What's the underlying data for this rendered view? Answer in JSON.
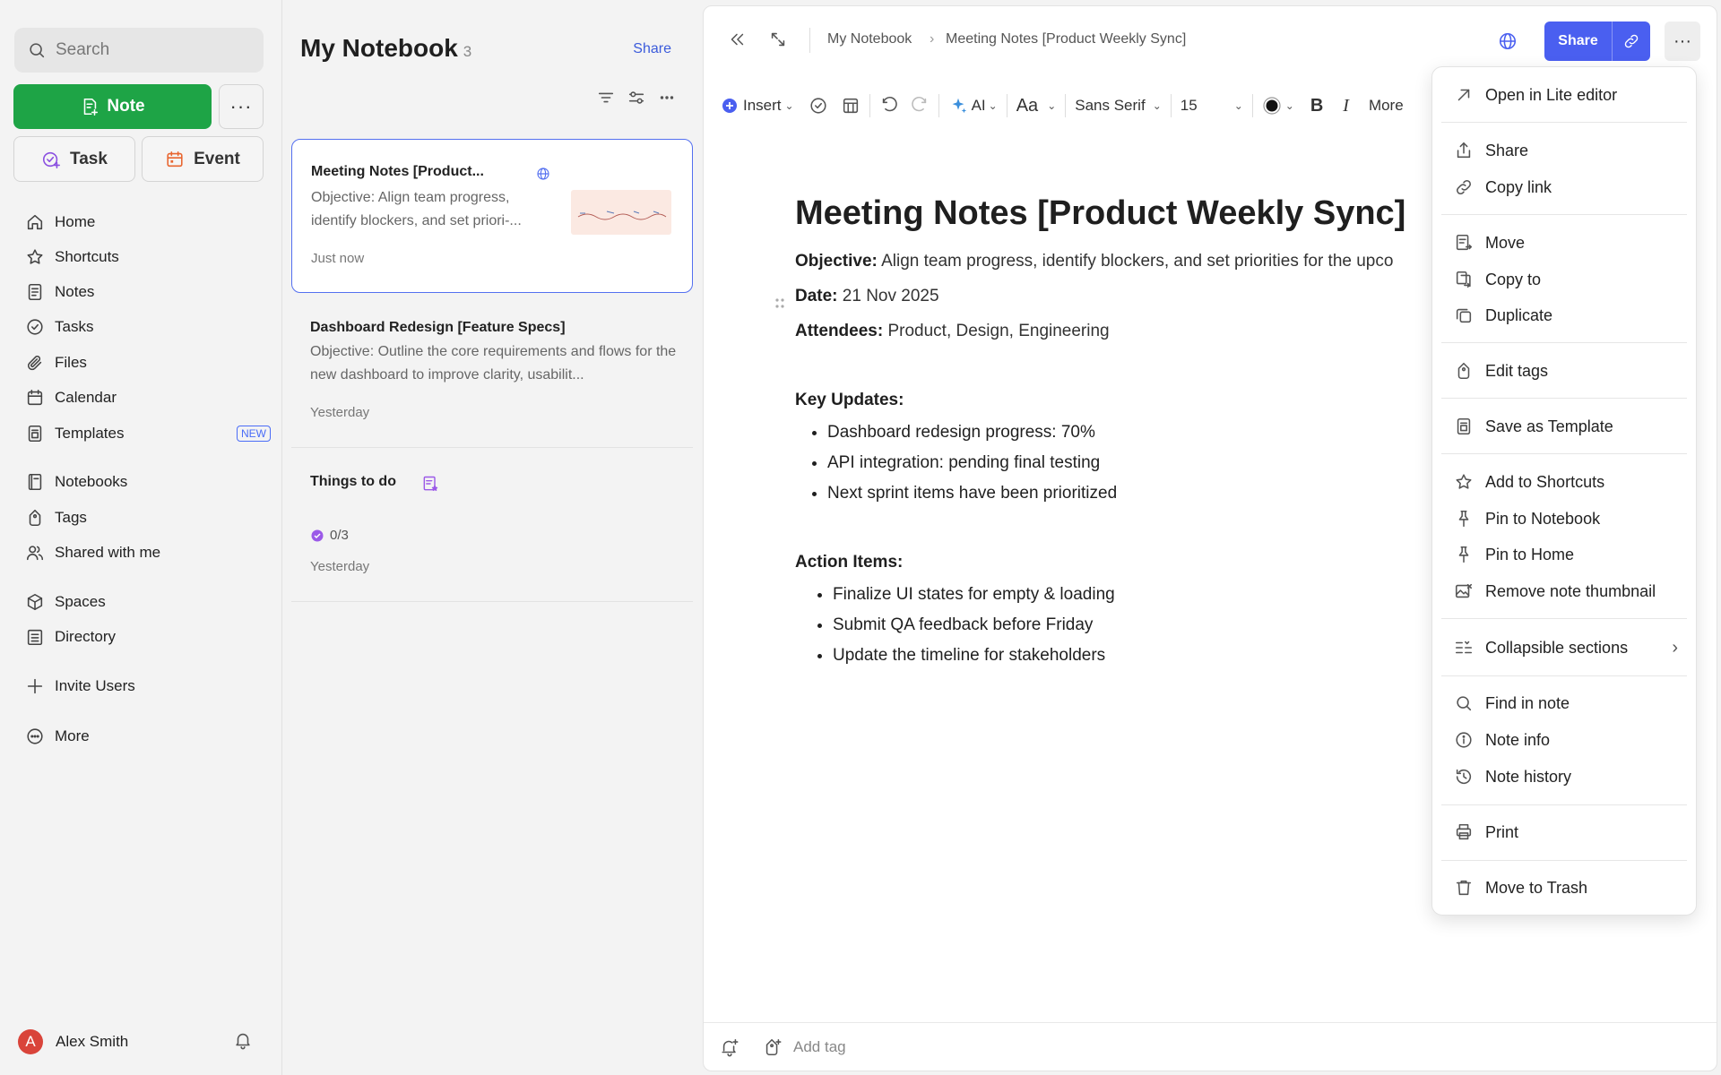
{
  "sidebar": {
    "search_placeholder": "Search",
    "note_button": "Note",
    "more_button": "···",
    "task_button": "Task",
    "event_button": "Event",
    "nav": [
      {
        "label": "Home",
        "icon": "home-icon"
      },
      {
        "label": "Shortcuts",
        "icon": "star-icon"
      },
      {
        "label": "Notes",
        "icon": "note-icon"
      },
      {
        "label": "Tasks",
        "icon": "check-circle-icon"
      },
      {
        "label": "Files",
        "icon": "paperclip-icon"
      },
      {
        "label": "Calendar",
        "icon": "calendar-icon"
      },
      {
        "label": "Templates",
        "icon": "template-icon",
        "badge": "NEW"
      },
      {
        "label": "Notebooks",
        "icon": "notebook-icon"
      },
      {
        "label": "Tags",
        "icon": "tag-icon"
      },
      {
        "label": "Shared with me",
        "icon": "people-icon"
      },
      {
        "label": "Spaces",
        "icon": "cube-icon"
      },
      {
        "label": "Directory",
        "icon": "directory-icon"
      },
      {
        "label": "Invite Users",
        "icon": "plus-icon"
      },
      {
        "label": "More",
        "icon": "more-circle-icon"
      }
    ],
    "user": {
      "initial": "A",
      "name": "Alex Smith"
    }
  },
  "notelist": {
    "title": "My Notebook",
    "count": "3",
    "share": "Share",
    "notes": [
      {
        "title": "Meeting Notes [Product...",
        "snippet": "Objective: Align team progress, identify blockers, and set priori-...",
        "time": "Just now"
      },
      {
        "title": "Dashboard Redesign [Feature Specs]",
        "snippet": "Objective: Outline the core requirements and flows for the new dashboard to improve clarity, usabilit...",
        "time": "Yesterday"
      },
      {
        "title": "Things to do",
        "progress": "0/3",
        "time": "Yesterday"
      }
    ]
  },
  "editor": {
    "breadcrumb": [
      "My Notebook",
      "Meeting Notes [Product Weekly Sync]"
    ],
    "share": "Share",
    "more": "···",
    "toolbar": {
      "insert": "Insert",
      "ai": "AI",
      "font_size_label": "Aa",
      "font": "Sans Serif",
      "size": "15",
      "bold": "B",
      "italic": "I",
      "more": "More"
    },
    "doc": {
      "title": "Meeting Notes [Product Weekly Sync]",
      "objective_label": "Objective:",
      "objective": " Align team progress, identify blockers, and set priorities for the upco",
      "date_label": "Date:",
      "date": " 21 Nov 2025",
      "attendees_label": "Attendees:",
      "attendees": " Product, Design, Engineering",
      "key_updates_heading": "Key Updates:",
      "key_updates": [
        "Dashboard redesign progress: 70%",
        "API integration: pending final testing",
        "Next sprint items have been prioritized"
      ],
      "action_items_heading": "Action Items:",
      "action_items": [
        "Finalize UI states for empty & loading",
        "Submit QA feedback before Friday",
        "Update the timeline for stakeholders"
      ]
    },
    "footer": {
      "add_tag": "Add tag"
    }
  },
  "menu": {
    "items": [
      {
        "label": "Open in Lite editor",
        "icon": "arrow-up-right-icon"
      },
      {
        "label": "Share",
        "icon": "share-icon"
      },
      {
        "label": "Copy link",
        "icon": "link-icon"
      },
      {
        "label": "Move",
        "icon": "move-icon"
      },
      {
        "label": "Copy to",
        "icon": "copy-to-icon"
      },
      {
        "label": "Duplicate",
        "icon": "duplicate-icon"
      },
      {
        "label": "Edit tags",
        "icon": "tag-icon"
      },
      {
        "label": "Save as Template",
        "icon": "template-icon"
      },
      {
        "label": "Add to Shortcuts",
        "icon": "star-icon"
      },
      {
        "label": "Pin to Notebook",
        "icon": "pin-icon"
      },
      {
        "label": "Pin to Home",
        "icon": "pin-icon"
      },
      {
        "label": "Remove note thumbnail",
        "icon": "image-remove-icon"
      },
      {
        "label": "Collapsible sections",
        "icon": "collapse-icon"
      },
      {
        "label": "Find in note",
        "icon": "search-icon"
      },
      {
        "label": "Note info",
        "icon": "info-icon"
      },
      {
        "label": "Note history",
        "icon": "history-icon"
      },
      {
        "label": "Print",
        "icon": "print-icon"
      },
      {
        "label": "Move to Trash",
        "icon": "trash-icon"
      }
    ]
  },
  "colors": {
    "primary_green": "#1ea446",
    "accent_blue": "#4a5ff0",
    "badge_blue": "#4a6cf7"
  }
}
